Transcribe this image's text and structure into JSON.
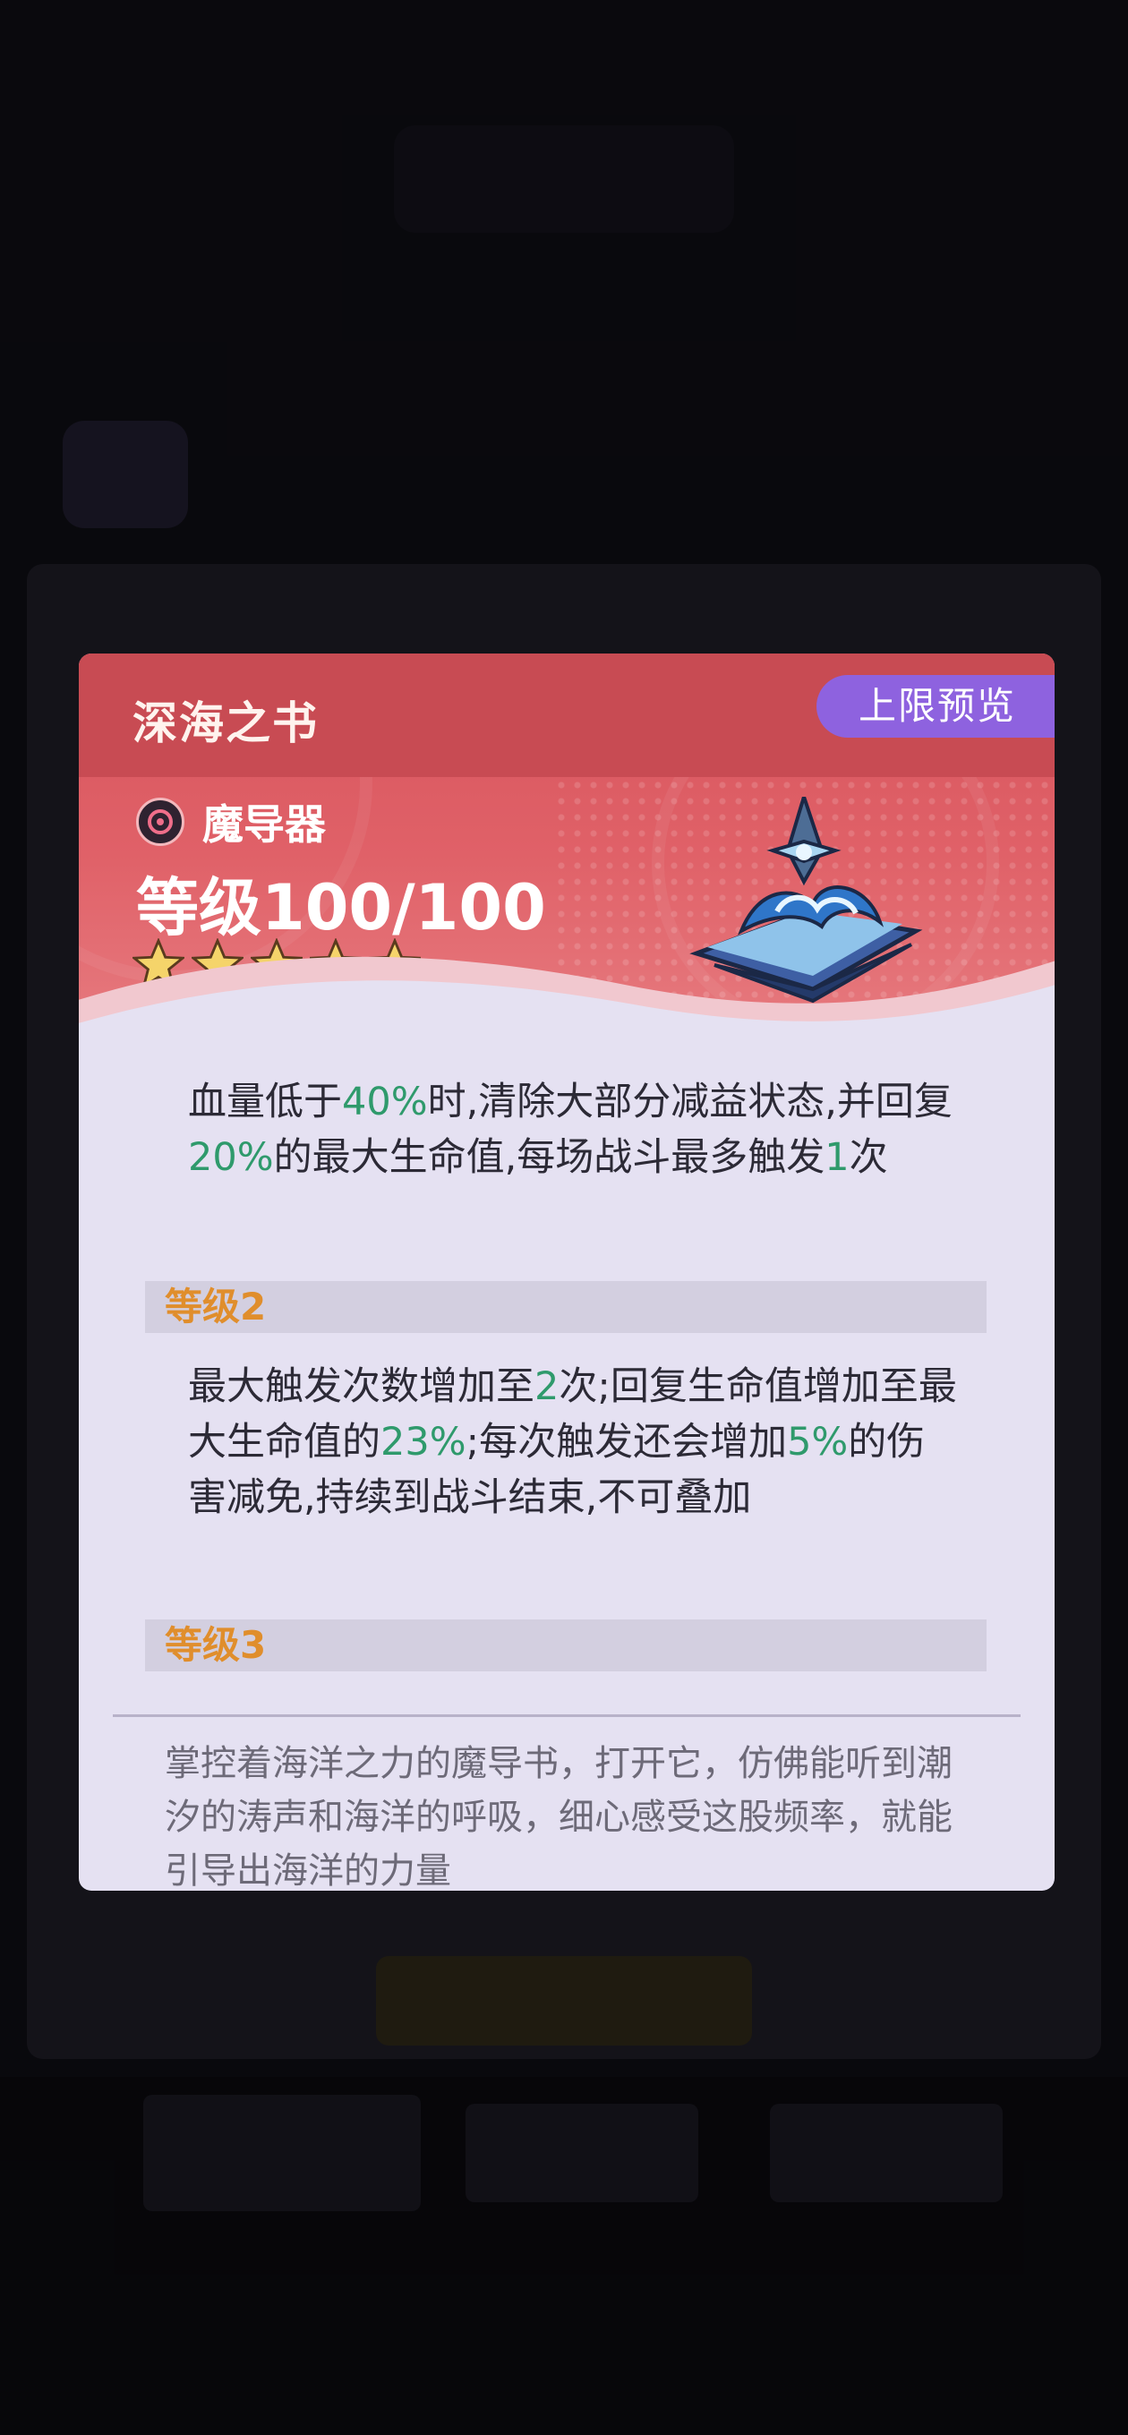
{
  "card": {
    "title": "深海之书",
    "badge_label": "上限预览",
    "item_type": "魔导器",
    "item_type_icon": "magic-device-icon",
    "level_text": "等级100/100",
    "stars": 5,
    "accent_color": "#d7555d",
    "badge_color": "#8e62df",
    "highlight_color": "#2f9a6c",
    "level_label_color": "#e08e2c"
  },
  "effects": {
    "level1": {
      "p1": "血量低于",
      "v1": "40%",
      "p2": "时,清除大部分减益状态,并回复",
      "v2": "20%",
      "p3": "的最大生命值,每场战斗最多触发",
      "v3": "1",
      "p4": "次"
    },
    "level2": {
      "label": "等级2",
      "p1": "最大触发次数增加至",
      "v1": "2",
      "p2": "次;回复生命值增加至最大生命值的",
      "v2": "23%",
      "p3": ";每次触发还会增加",
      "v3": "5%",
      "p4": "的伤害减免,持续到战斗结束,不可叠加"
    },
    "level3": {
      "label": "等级3"
    }
  },
  "lore": "掌控着海洋之力的魔导书，打开它，仿佛能听到潮汐的涛声和海洋的呼吸，细心感受这股频率，就能引导出海洋的力量"
}
